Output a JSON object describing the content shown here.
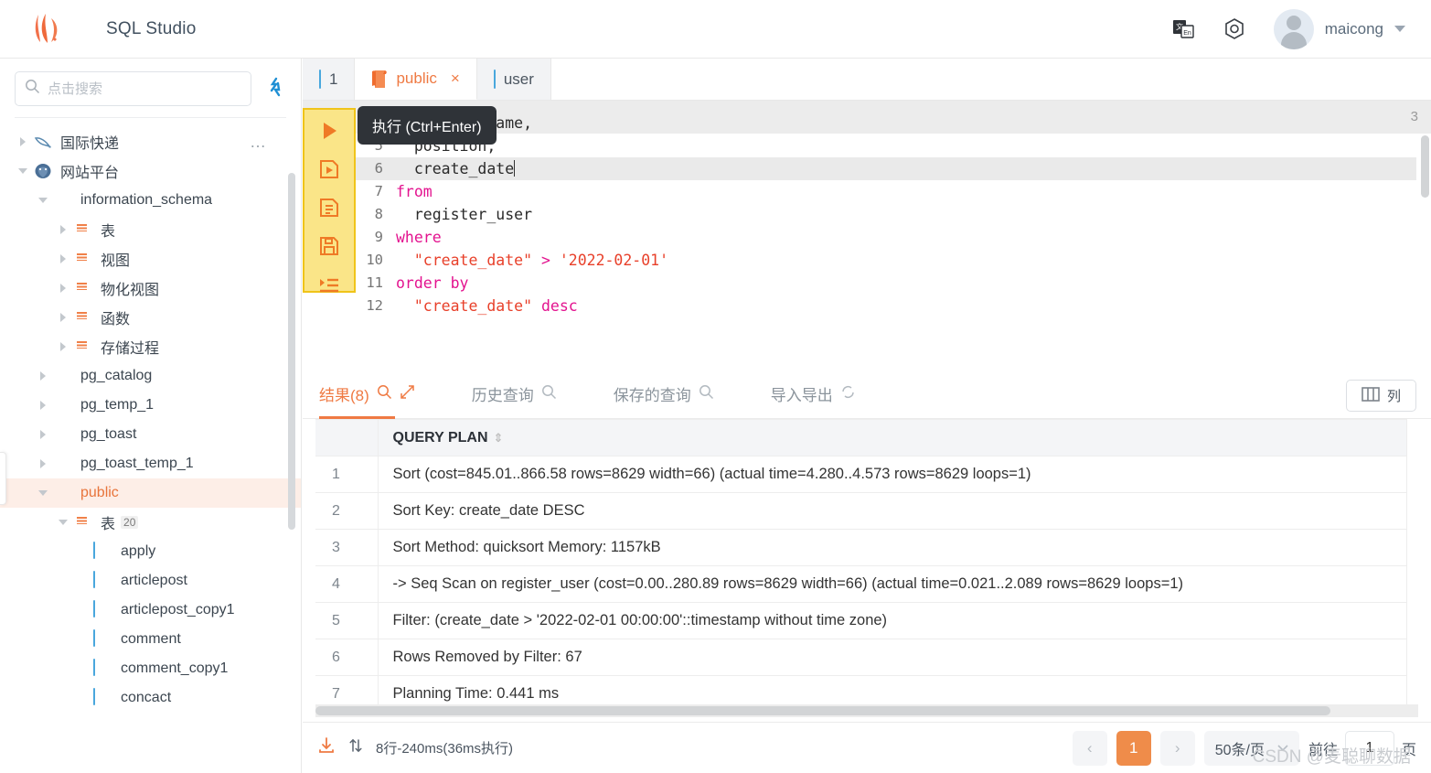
{
  "header": {
    "app_title": "SQL Studio",
    "logo_icon": "flame-logo-icon",
    "translate_icon": "translate-icon",
    "settings_icon": "gear-icon",
    "username": "maicong",
    "caret_icon": "chevron-down-icon"
  },
  "sidebar": {
    "search_placeholder": "点击搜索",
    "search_value": "",
    "search_icon": "search-icon",
    "refresh_icon": "refresh-icon",
    "tree": [
      {
        "label": "国际快递",
        "icon": "mysql-icon",
        "indent": 0,
        "expanded": false,
        "selected": false,
        "menu": "…"
      },
      {
        "label": "网站平台",
        "icon": "postgres-icon",
        "indent": 0,
        "expanded": true,
        "selected": false
      },
      {
        "label": "information_schema",
        "icon": "schema-icon",
        "indent": 1,
        "expanded": true,
        "selected": false
      },
      {
        "label": "表",
        "icon": "folder-table-icon",
        "indent": 2,
        "expanded": false,
        "selected": false
      },
      {
        "label": "视图",
        "icon": "folder-view-icon",
        "indent": 2,
        "expanded": false,
        "selected": false
      },
      {
        "label": "物化视图",
        "icon": "folder-matview-icon",
        "indent": 2,
        "expanded": false,
        "selected": false
      },
      {
        "label": "函数",
        "icon": "folder-function-icon",
        "indent": 2,
        "expanded": false,
        "selected": false
      },
      {
        "label": "存储过程",
        "icon": "folder-procedure-icon",
        "indent": 2,
        "expanded": false,
        "selected": false
      },
      {
        "label": "pg_catalog",
        "icon": "schema-icon",
        "indent": 1,
        "expanded": false,
        "selected": false
      },
      {
        "label": "pg_temp_1",
        "icon": "schema-icon",
        "indent": 1,
        "expanded": false,
        "selected": false
      },
      {
        "label": "pg_toast",
        "icon": "schema-icon",
        "indent": 1,
        "expanded": false,
        "selected": false
      },
      {
        "label": "pg_toast_temp_1",
        "icon": "schema-icon",
        "indent": 1,
        "expanded": false,
        "selected": false
      },
      {
        "label": "public",
        "icon": "schema-icon",
        "indent": 1,
        "expanded": true,
        "selected": true
      },
      {
        "label": "表",
        "icon": "folder-table-icon",
        "indent": 2,
        "expanded": true,
        "selected": false,
        "count": "20"
      },
      {
        "label": "apply",
        "icon": "table-icon",
        "indent": 3,
        "leaf": true
      },
      {
        "label": "articlepost",
        "icon": "table-icon",
        "indent": 3,
        "leaf": true
      },
      {
        "label": "articlepost_copy1",
        "icon": "table-icon",
        "indent": 3,
        "leaf": true
      },
      {
        "label": "comment",
        "icon": "table-icon",
        "indent": 3,
        "leaf": true
      },
      {
        "label": "comment_copy1",
        "icon": "table-icon",
        "indent": 3,
        "leaf": true
      },
      {
        "label": "concact",
        "icon": "table-icon",
        "indent": 3,
        "leaf": true
      }
    ]
  },
  "tabs": [
    {
      "label": "1",
      "icon": "table-icon",
      "active": false,
      "closable": false
    },
    {
      "label": "public",
      "icon": "script-icon",
      "active": true,
      "closable": true,
      "close_label": "×"
    },
    {
      "label": "user",
      "icon": "table-icon",
      "active": false,
      "closable": false
    }
  ],
  "editor": {
    "tooltip": "执行 (Ctrl+Enter)",
    "minimap_number": "3",
    "toolbar_icons": [
      {
        "name": "run-icon",
        "title": "执行"
      },
      {
        "name": "run-script-icon",
        "title": "执行脚本"
      },
      {
        "name": "explain-plan-icon",
        "title": "执行计划"
      },
      {
        "name": "save-icon",
        "title": "保存"
      },
      {
        "name": "format-icon",
        "title": "格式化"
      }
    ],
    "lines": [
      {
        "no": "4",
        "tokens": [
          {
            "t": "  company_name,",
            "c": "plain"
          }
        ]
      },
      {
        "no": "5",
        "tokens": [
          {
            "t": "  position,",
            "c": "plain"
          }
        ]
      },
      {
        "no": "6",
        "tokens": [
          {
            "t": "  create_date",
            "c": "plain"
          }
        ],
        "highlight": true,
        "cursor": true
      },
      {
        "no": "7",
        "tokens": [
          {
            "t": "from",
            "c": "kw"
          }
        ]
      },
      {
        "no": "8",
        "tokens": [
          {
            "t": "  register_user",
            "c": "plain"
          }
        ]
      },
      {
        "no": "9",
        "tokens": [
          {
            "t": "where",
            "c": "kw"
          }
        ]
      },
      {
        "no": "10",
        "tokens": [
          {
            "t": "  \"create_date\" ",
            "c": "str"
          },
          {
            "t": "> ",
            "c": "kw"
          },
          {
            "t": "'2022-02-01'",
            "c": "str"
          }
        ]
      },
      {
        "no": "11",
        "tokens": [
          {
            "t": "order by",
            "c": "kw"
          }
        ]
      },
      {
        "no": "12",
        "tokens": [
          {
            "t": "  \"create_date\" ",
            "c": "str"
          },
          {
            "t": "desc",
            "c": "kw"
          }
        ]
      }
    ]
  },
  "result_tabs": [
    {
      "label": "结果(8)",
      "icon": "search-icon",
      "extra_icon": "expand-icon",
      "active": true
    },
    {
      "label": "历史查询",
      "icon": "search-icon",
      "active": false
    },
    {
      "label": "保存的查询",
      "icon": "search-icon",
      "active": false
    },
    {
      "label": "导入导出",
      "icon": "sync-icon",
      "active": false
    }
  ],
  "columns_button": {
    "label": "列",
    "icon": "columns-icon"
  },
  "grid": {
    "index_header": "",
    "column_header": "QUERY PLAN",
    "sort_icon": "sort-updown-icon",
    "rows": [
      {
        "n": "1",
        "v": "Sort (cost=845.01..866.58 rows=8629 width=66) (actual time=4.280..4.573 rows=8629 loops=1)"
      },
      {
        "n": "2",
        "v": "Sort Key: create_date DESC"
      },
      {
        "n": "3",
        "v": "Sort Method: quicksort Memory: 1157kB"
      },
      {
        "n": "4",
        "v": "-> Seq Scan on register_user (cost=0.00..280.89 rows=8629 width=66) (actual time=0.021..2.089 rows=8629 loops=1)"
      },
      {
        "n": "5",
        "v": "Filter: (create_date > '2022-02-01 00:00:00'::timestamp without time zone)"
      },
      {
        "n": "6",
        "v": "Rows Removed by Filter: 67"
      },
      {
        "n": "7",
        "v": "Planning Time: 0.441 ms"
      }
    ]
  },
  "footer": {
    "download_icon": "download-icon",
    "sort_icon": "updown-arrows-icon",
    "status": "8行-240ms(36ms执行)",
    "prev_label": "‹",
    "current_page": "1",
    "next_label": "›",
    "page_size": "50条/页",
    "page_size_caret": "chevron-down-icon",
    "jump_label": "前往",
    "jump_value": "1",
    "jump_suffix": "页"
  },
  "watermark": "CSDN @麦聪聊数据",
  "colors": {
    "accent": "#ef7a43",
    "highlight_box": "#fae588",
    "highlight_border": "#f0c419",
    "keyword": "#e3138f",
    "string": "#e8402a"
  }
}
